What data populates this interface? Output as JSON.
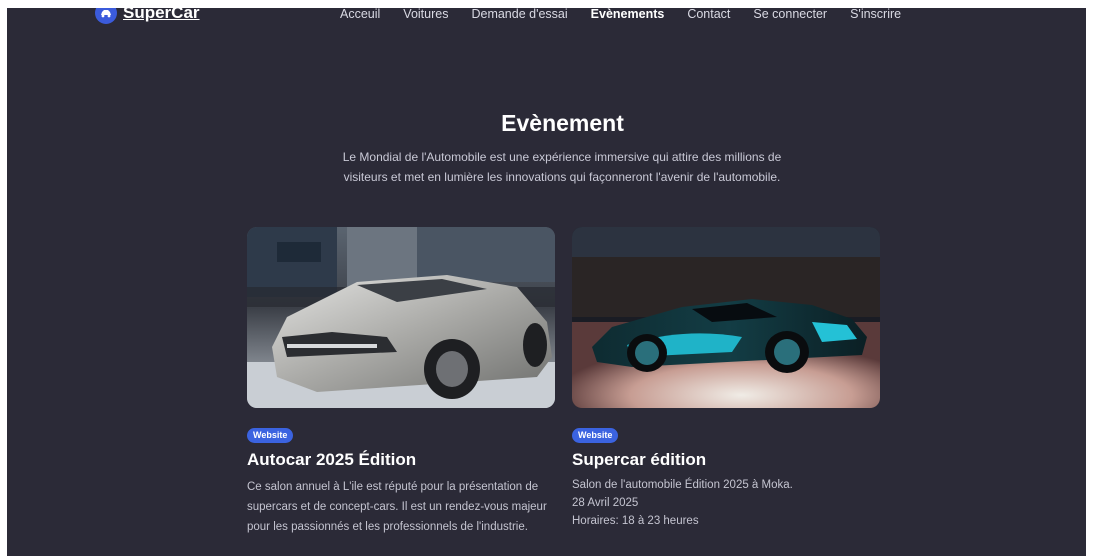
{
  "header": {
    "brand": "SuperCar",
    "nav": [
      {
        "label": "Acceuil"
      },
      {
        "label": "Voitures"
      },
      {
        "label": "Demande d'essai"
      },
      {
        "label": "Evènements",
        "active": true
      },
      {
        "label": "Contact"
      },
      {
        "label": "Se connecter"
      },
      {
        "label": "S'inscrire"
      }
    ]
  },
  "hero": {
    "title": "Evènement",
    "description": "Le Mondial de l'Automobile est une expérience immersive qui attire des millions de visiteurs et met en lumière les innovations qui façonneront l'avenir de l'automobile."
  },
  "cards": [
    {
      "badge": "Website",
      "title": "Autocar 2025 Édition",
      "description": "Ce salon annuel à L'ile est réputé pour la présentation de supercars et de concept-cars. Il est un rendez-vous majeur pour les passionnés et les professionnels de l'industrie."
    },
    {
      "badge": "Website",
      "title": "Supercar édition",
      "lines": [
        "Salon de l'automobile Édition 2025 à Moka.",
        "28 Avril 2025",
        "Horaires: 18 à 23 heures"
      ]
    }
  ],
  "colors": {
    "background": "#2b2a37",
    "accent": "#3b63e0"
  }
}
